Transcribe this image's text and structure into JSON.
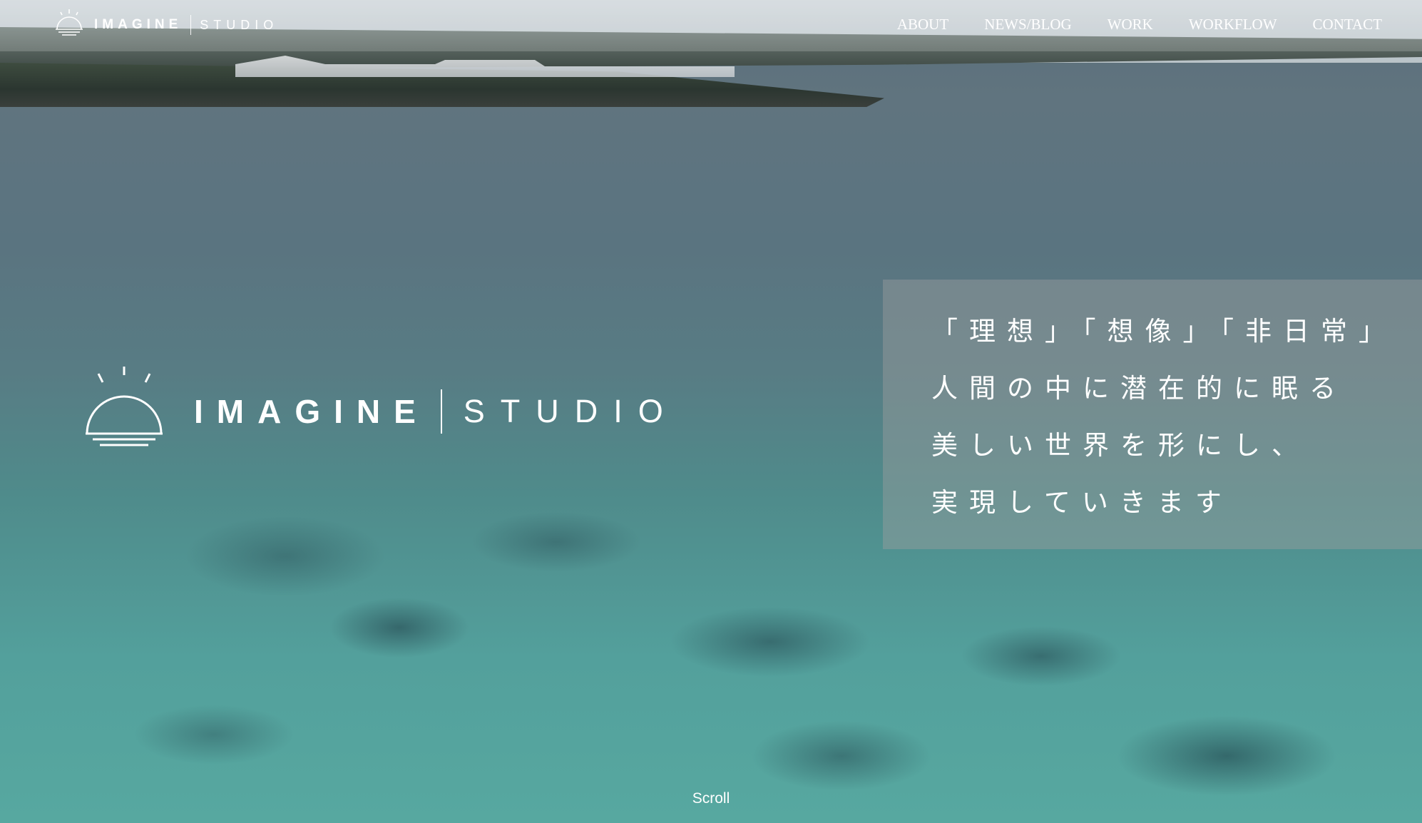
{
  "header": {
    "logo": {
      "brand": "IMAGINE",
      "sub": "STUDIO"
    },
    "nav": [
      {
        "label": "ABOUT"
      },
      {
        "label": "NEWS/BLOG"
      },
      {
        "label": "WORK"
      },
      {
        "label": "WORKFLOW"
      },
      {
        "label": "CONTACT"
      }
    ]
  },
  "hero": {
    "logo": {
      "brand": "IMAGINE",
      "sub": "STUDIO"
    },
    "tagline": [
      "「理想」「想像」「非日常」",
      "人間の中に潜在的に眠る",
      "美しい世界を形にし、",
      "実現していきます"
    ],
    "scroll_label": "Scroll"
  },
  "icons": {
    "header_logo": "sunrise-logo-icon",
    "hero_logo": "sunrise-logo-icon"
  }
}
